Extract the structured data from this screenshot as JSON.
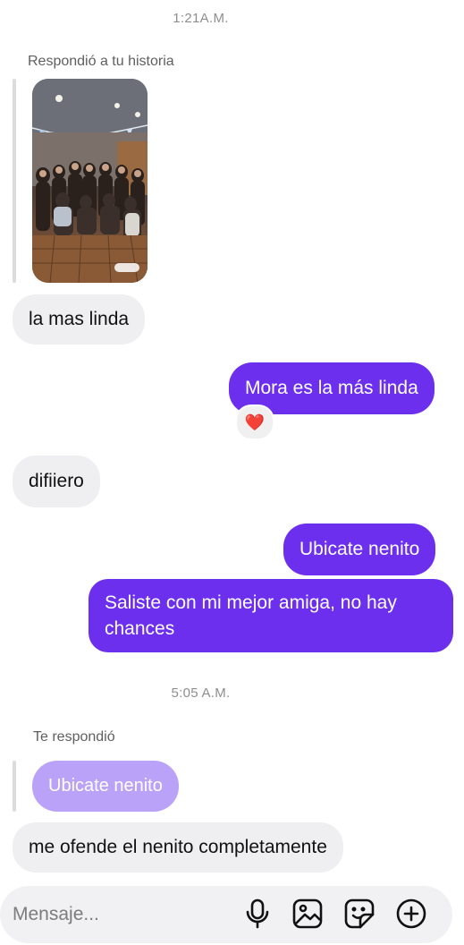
{
  "conversation": {
    "timestamps": [
      "1:21A.M.",
      "5:05 A.M."
    ],
    "story_reply": {
      "label": "Respondió a tu historia",
      "image_icon": "story-photo-group-of-people"
    },
    "messages": [
      {
        "side": "incoming",
        "text": "la mas linda"
      },
      {
        "side": "outgoing",
        "text": "Mora es la más linda",
        "reaction": "❤️"
      },
      {
        "side": "incoming",
        "text": "difiiero"
      },
      {
        "side": "outgoing",
        "text": "Ubicate nenito"
      },
      {
        "side": "outgoing",
        "text": "Saliste con mi mejor amiga, no hay chances"
      },
      {
        "side": "incoming",
        "text": "me ofende el nenito completamente"
      }
    ],
    "reply_quote": {
      "label": "Te respondió",
      "quoted_text": "Ubicate nenito"
    }
  },
  "composer": {
    "placeholder": "Mensaje...",
    "icons": [
      "microphone-icon",
      "image-icon",
      "sticker-icon",
      "plus-circle-icon"
    ]
  },
  "colors": {
    "outgoing_bubble": "#6d2fee",
    "quoted_bubble": "#b9a2f7",
    "incoming_bubble": "#efeff1"
  }
}
